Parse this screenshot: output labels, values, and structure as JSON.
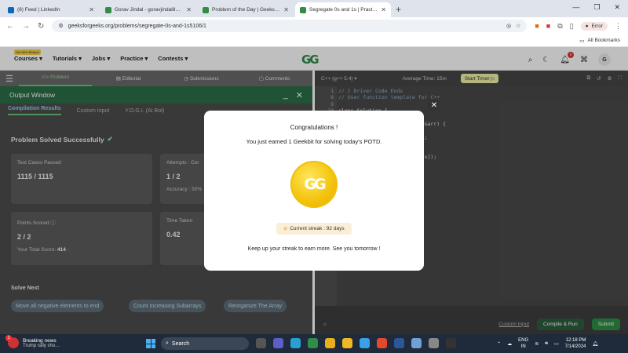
{
  "browser": {
    "tabs": [
      {
        "label": "(8) Feed | LinkedIn",
        "color": "#0a66c2",
        "active": false
      },
      {
        "label": "Gorav Jindal - goravjindal86 | M",
        "color": "#2f8d46",
        "active": false
      },
      {
        "label": "Problem of the Day | GeeksforG",
        "color": "#2f8d46",
        "active": false
      },
      {
        "label": "Segregate 0s and 1s | Practice |",
        "color": "#2f8d46",
        "active": true
      }
    ],
    "url": "geeksforgeeks.org/problems/segregate-0s-and-1s5106/1",
    "error_label": "Error",
    "all_bookmarks": "All Bookmarks"
  },
  "header": {
    "refund_badge": "Get 90% Refund",
    "menu": [
      "Courses",
      "Tutorials",
      "Jobs",
      "Practice",
      "Contests"
    ],
    "notification_count": "9",
    "avatar_initial": "G"
  },
  "problem_tabs": [
    "Problem",
    "Editorial",
    "Submissions",
    "Comments"
  ],
  "output_window": {
    "title": "Output Window",
    "tabs": [
      "Compilation Results",
      "Custom Input",
      "Y.O.G.I. (AI Bot)"
    ],
    "status": "Problem Solved Successfully",
    "cards": {
      "test_cases_label": "Test Cases Passed",
      "test_cases_value": "1115 / 1115",
      "attempts_label": "Attempts : Cor",
      "attempts_value": "1 / 2",
      "accuracy_label": "Accuracy : 50%",
      "points_label": "Points Scored",
      "points_value": "2 / 2",
      "total_score_label": "Your Total Score:",
      "total_score_value": "414",
      "time_label": "Time Taken",
      "time_value": "0.42"
    },
    "solve_next_title": "Solve Next",
    "solve_next": [
      "Move all negative elements to end",
      "Count increasing Subarrays",
      "Reorganize The Array"
    ]
  },
  "editor": {
    "language": "C++ (g++ 5.4)",
    "avg_time": "Average Time: 15m",
    "start_timer": "Start Timer",
    "line_numbers": [
      "1",
      "8",
      "9",
      "10",
      "11",
      "12",
      "13",
      "14",
      "15",
      "16",
      "17"
    ],
    "code_lines": [
      "// } Driver Code Ends",
      "// User function template for C++",
      "",
      "class Solution {",
      "",
      "                    or<int> &arr) {",
      "",
      "                    r.size();",
      "                    ; i++){",
      "",
      "                    arr[++pos]);"
    ],
    "custom_input": "Custom Input",
    "compile_run": "Compile & Run",
    "submit": "Submit"
  },
  "modal": {
    "title": "Congratulations !",
    "subtitle": "You just earned 1 Geekbit for solving today's POTD.",
    "streak": "Current streak : 92 days",
    "footer": "Keep up your streak to earn more. See you tomorrow !"
  },
  "taskbar": {
    "news_title": "Breaking news",
    "news_sub": "Trump rally sho...",
    "search": "Search",
    "lang1": "ENG",
    "lang2": "IN",
    "time": "12:18 PM",
    "date": "7/14/2024"
  }
}
